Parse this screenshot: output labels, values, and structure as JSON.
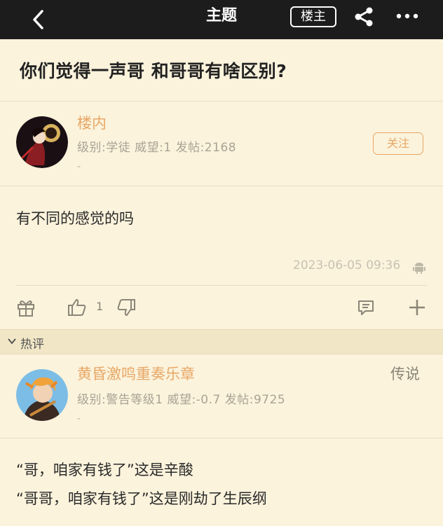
{
  "topbar": {
    "title": "主题",
    "owner_label": "楼主"
  },
  "post": {
    "title": "你们觉得一声哥 和哥哥有啥区别?",
    "author": {
      "name": "楼内",
      "meta": "级别:学徒  威望:1  发帖:2168",
      "dash": "-",
      "follow_label": "关注"
    },
    "body": "有不同的感觉的吗",
    "timestamp": "2023-06-05 09:36",
    "like_count": "1"
  },
  "hot": {
    "section_label": "热评",
    "comment": {
      "author": {
        "name": "黄昏激鸣重奏乐章",
        "rank": "传说",
        "meta": "级别:警告等级1  威望:-0.7  发帖:9725",
        "dash": "-"
      },
      "lines": [
        "“哥，咱家有钱了”这是辛酸",
        "“哥哥，咱家有钱了”这是刚劫了生辰纲"
      ]
    }
  },
  "colors": {
    "topbar": "#1c1c1c",
    "background": "#fbf3dc",
    "accent": "#e8a766"
  },
  "icons": [
    "back-icon",
    "share-icon",
    "more-icon",
    "android-icon",
    "gift-icon",
    "like-icon",
    "dislike-icon",
    "comment-icon",
    "plus-icon",
    "chevron-down-icon"
  ]
}
